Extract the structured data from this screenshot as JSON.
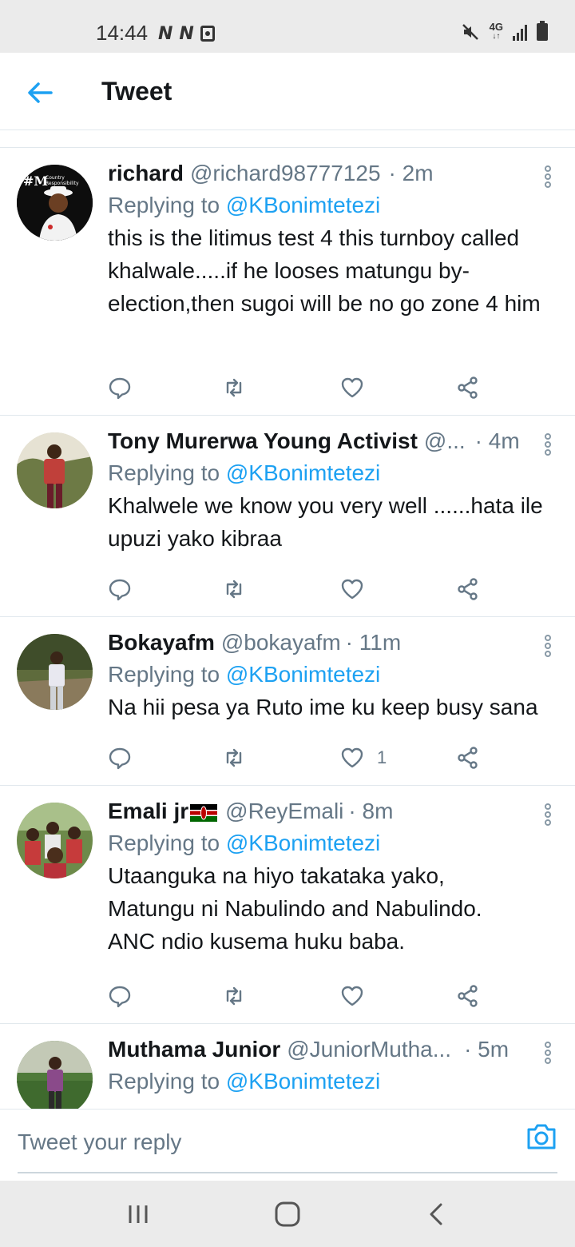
{
  "status_bar": {
    "time": "14:44",
    "notification_icons": [
      "n-icon",
      "n-icon",
      "calendar-icon"
    ],
    "network": "4G",
    "right_icons": [
      "mute-icon",
      "4g-icon",
      "signal-icon",
      "battery-icon"
    ]
  },
  "header": {
    "back_icon": "arrow-left-icon",
    "title": "Tweet"
  },
  "tweets": [
    {
      "name": "richard",
      "handle": "@richard98777125",
      "time": "· 2m",
      "replying_prefix": "Replying to ",
      "replying_to": "@KBonimtetezi",
      "text": "this is the litimus test 4 this turnboy called khalwale.....if he looses matungu by-election,then sugoi will be no go zone 4 him",
      "likes": ""
    },
    {
      "name": "Tony Murerwa Young Activist",
      "handle": "@...",
      "time": "· 4m",
      "replying_prefix": "Replying to ",
      "replying_to": "@KBonimtetezi",
      "text": "Khalwele we know you very well ......hata ile upuzi yako kibraa",
      "likes": ""
    },
    {
      "name": "Bokayafm",
      "handle": "@bokayafm",
      "time": "· 11m",
      "replying_prefix": "Replying to ",
      "replying_to": "@KBonimtetezi",
      "text": "Na hii pesa ya Ruto ime ku keep busy sana",
      "likes": "1"
    },
    {
      "name": "Emali jr",
      "handle": "@ReyEmali",
      "time": "· 8m",
      "replying_prefix": "Replying to ",
      "replying_to": "@KBonimtetezi",
      "text": "Utaanguka na hiyo takataka yako, Matungu ni Nabulindo and Nabulindo. ANC ndio kusema huku baba.",
      "likes": ""
    },
    {
      "name": "Muthama Junior",
      "handle": "@JuniorMutha...",
      "time": "· 5m",
      "replying_prefix": "Replying to ",
      "replying_to": "@KBonimtetezi",
      "text": "",
      "likes": ""
    }
  ],
  "reply_bar": {
    "placeholder": "Tweet your reply",
    "camera_icon": "camera-icon"
  },
  "nav_bar": {
    "icons": [
      "recent-apps-icon",
      "home-icon",
      "back-icon"
    ]
  },
  "colors": {
    "accent": "#1da1f2",
    "text": "#14171a",
    "secondary": "#657786",
    "divider": "#e1e8ed",
    "system_bar": "#ebebeb"
  }
}
